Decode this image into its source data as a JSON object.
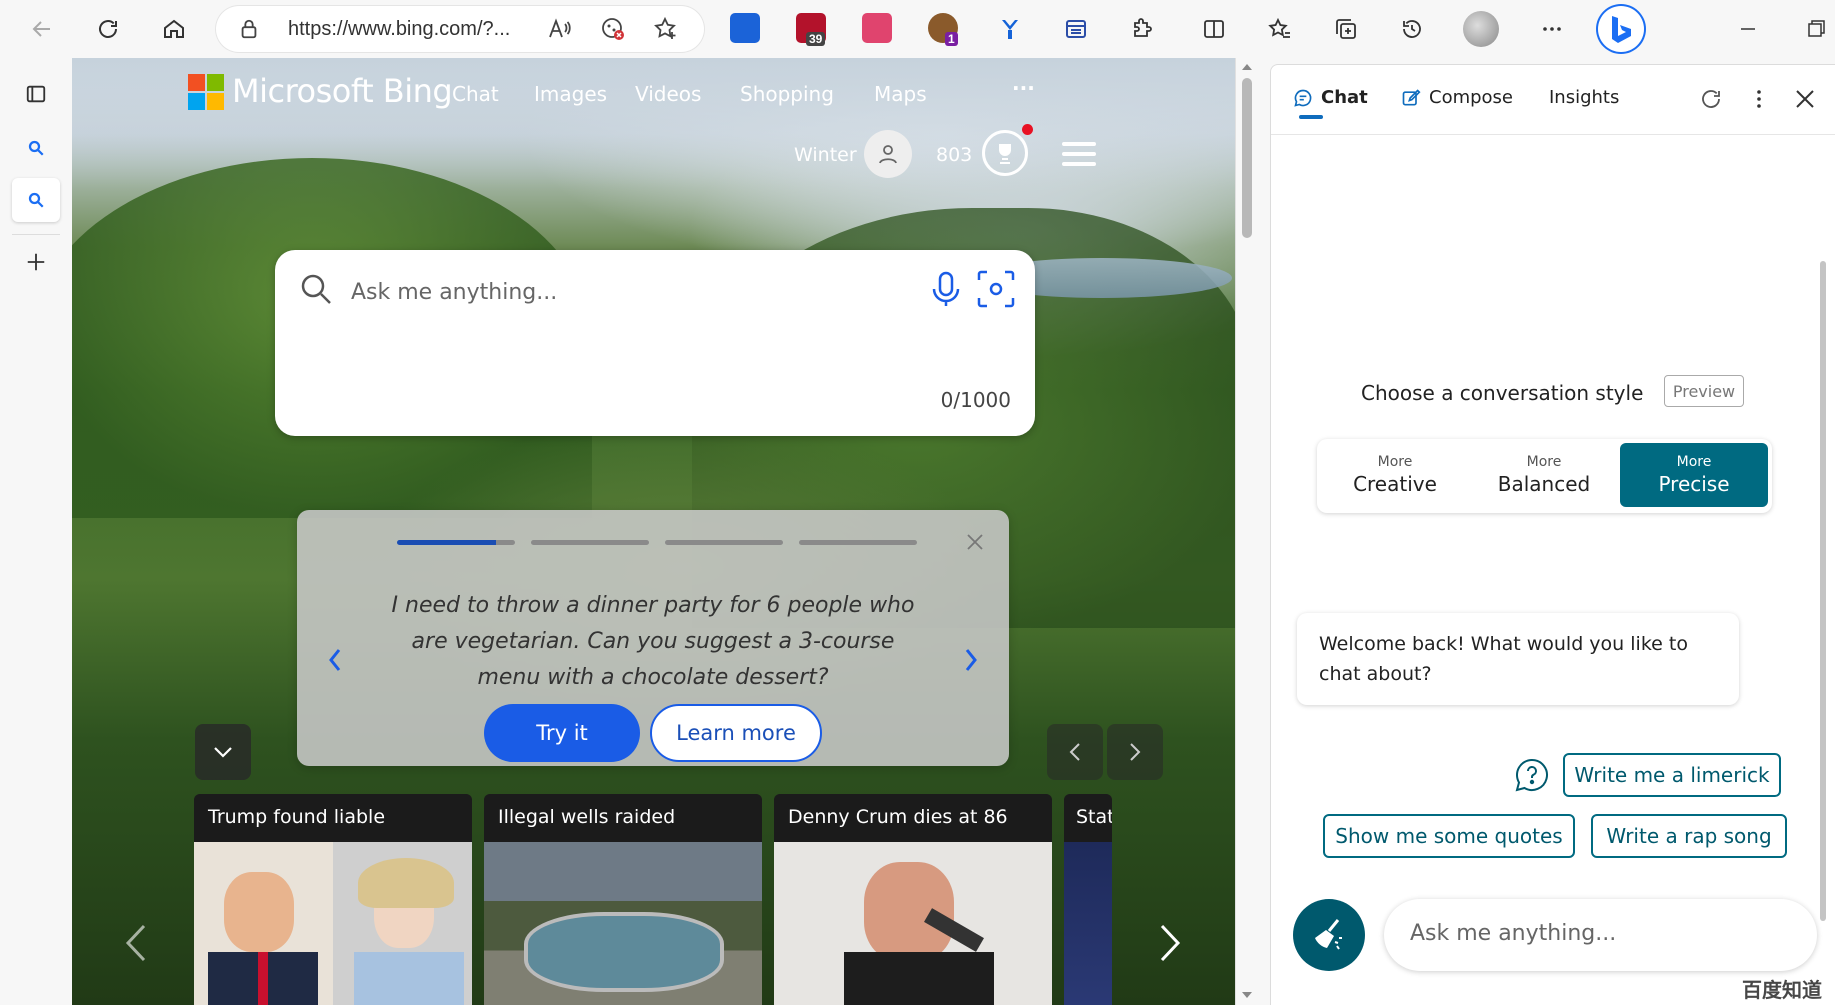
{
  "browser": {
    "url": "https://www.bing.com/?...",
    "extension_badges": {
      "ublock": "39",
      "tampermonkey": "1"
    }
  },
  "bing": {
    "brand": "Microsoft Bing",
    "nav": [
      "Chat",
      "Images",
      "Videos",
      "Shopping",
      "Maps",
      "···"
    ],
    "user_name": "Winter",
    "points": "803",
    "search": {
      "placeholder": "Ask me anything...",
      "counter": "0/1000"
    },
    "promo": {
      "text": "I need to throw a dinner party for 6 people who are vegetarian. Can you suggest a 3-course menu with a chocolate dessert?",
      "try_label": "Try it",
      "learn_label": "Learn more",
      "active_slide_progress": 0.84,
      "slides": 4
    },
    "news": [
      {
        "headline": "Trump found liable"
      },
      {
        "headline": "Illegal wells raided"
      },
      {
        "headline": "Denny Crum dies at 86"
      },
      {
        "headline": "Stat"
      }
    ]
  },
  "sidebar": {
    "tabs": [
      "Chat",
      "Compose",
      "Insights"
    ],
    "style_label": "Choose a conversation style",
    "preview_badge": "Preview",
    "styles": [
      {
        "small": "More",
        "big": "Creative"
      },
      {
        "small": "More",
        "big": "Balanced"
      },
      {
        "small": "More",
        "big": "Precise"
      }
    ],
    "active_style": "Precise",
    "welcome": "Welcome back! What would you like to chat about?",
    "suggestions": [
      "Write me a limerick",
      "Show me some quotes",
      "Write a rap song"
    ],
    "input_placeholder": "Ask me anything..."
  },
  "watermark": "百度知道",
  "colors": {
    "accent": "#006a81",
    "bing_blue": "#1a5ce6"
  }
}
